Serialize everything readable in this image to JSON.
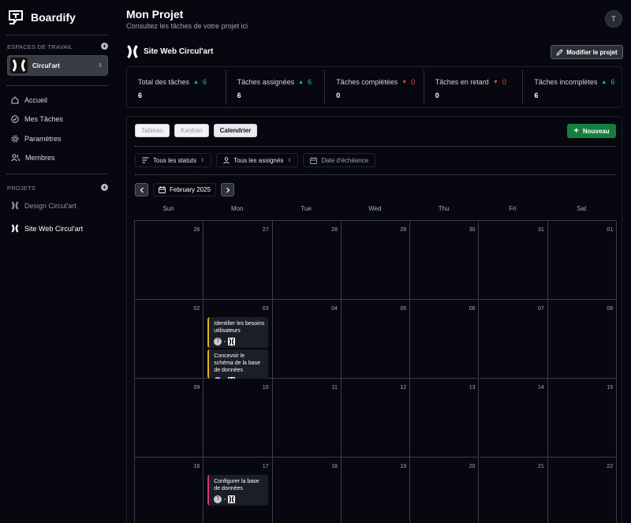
{
  "app": {
    "name": "Boardify"
  },
  "sidebar": {
    "workspaces_label": "ESPACES DE TRAVAIL",
    "workspace": {
      "name": "Circul'art"
    },
    "nav": [
      {
        "label": "Accueil",
        "icon": "home-icon"
      },
      {
        "label": "Mes Tâches",
        "icon": "check-circle-icon"
      },
      {
        "label": "Paramètres",
        "icon": "gear-icon"
      },
      {
        "label": "Membres",
        "icon": "users-icon"
      }
    ],
    "projects_label": "PROJETS",
    "projects": [
      {
        "label": "Design Circul'art",
        "active": false
      },
      {
        "label": "Site Web Circul'art",
        "active": true
      }
    ]
  },
  "header": {
    "title": "Mon Projet",
    "subtitle": "Consultez les tâches de votre projet ici",
    "avatar_initial": "T"
  },
  "project": {
    "name": "Site Web Circul'art",
    "edit_label": "Modifier le projet"
  },
  "stats": [
    {
      "label": "Total des tâches",
      "delta": "6",
      "trend": "up",
      "value": "6"
    },
    {
      "label": "Tâches assignées",
      "delta": "6",
      "trend": "up",
      "value": "6"
    },
    {
      "label": "Tâches complétées",
      "delta": "0",
      "trend": "down",
      "value": "0"
    },
    {
      "label": "Tâches en retard",
      "delta": "0",
      "trend": "down",
      "value": "0"
    },
    {
      "label": "Tâches incomplètes",
      "delta": "6",
      "trend": "up",
      "value": "6"
    }
  ],
  "views": {
    "tabs": [
      "Tableau",
      "Kanban",
      "Calendrier"
    ],
    "active": "Calendrier",
    "new_label": "Nouveau"
  },
  "filters": {
    "status": "Tous les statuts",
    "assignee": "Tous les assignés",
    "due_date": "Date d'échéance"
  },
  "calendar": {
    "month_label": "February 2025",
    "weekdays": [
      "Sun",
      "Mon",
      "Tue",
      "Wed",
      "Thu",
      "Fri",
      "Sat"
    ],
    "weeks": [
      [
        "26",
        "27",
        "28",
        "29",
        "30",
        "31",
        "01"
      ],
      [
        "02",
        "03",
        "04",
        "05",
        "06",
        "07",
        "08"
      ],
      [
        "09",
        "10",
        "11",
        "12",
        "13",
        "14",
        "15"
      ],
      [
        "16",
        "17",
        "18",
        "19",
        "20",
        "21",
        "22"
      ]
    ],
    "events": [
      {
        "week": 1,
        "day": 1,
        "slot": 0,
        "title": "Identifier les besoins utilisateurs",
        "assignee": "T",
        "color": "#e0b21e"
      },
      {
        "week": 1,
        "day": 1,
        "slot": 1,
        "title": "Concevoir le schéma de la base de données",
        "assignee": "T",
        "color": "#e0b21e"
      },
      {
        "week": 3,
        "day": 1,
        "slot": 0,
        "title": "Configurer la base de données",
        "assignee": "T",
        "color": "#d6337f"
      }
    ]
  },
  "colors": {
    "accent_green": "#15803d",
    "trend_up": "#22c08a",
    "trend_down": "#e5484d"
  }
}
